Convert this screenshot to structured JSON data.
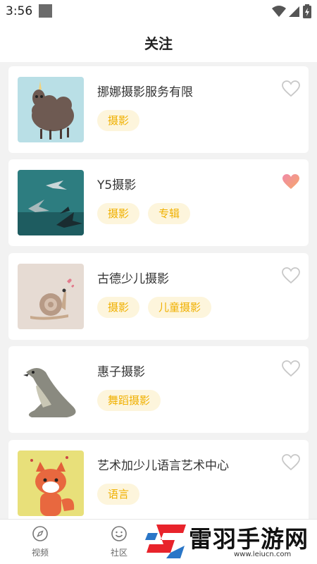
{
  "status_bar": {
    "time": "3:56"
  },
  "header": {
    "title": "关注"
  },
  "items": [
    {
      "name": "挪娜摄影服务有限",
      "tags": [
        "摄影"
      ],
      "liked": false,
      "thumb": "sheep"
    },
    {
      "name": "Y5摄影",
      "tags": [
        "摄影",
        "专辑"
      ],
      "liked": true,
      "thumb": "sea"
    },
    {
      "name": "古德少儿摄影",
      "tags": [
        "摄影",
        "儿童摄影"
      ],
      "liked": false,
      "thumb": "snail"
    },
    {
      "name": "惠子摄影",
      "tags": [
        "舞蹈摄影"
      ],
      "liked": false,
      "thumb": "sealion"
    },
    {
      "name": "艺术加少儿语言艺术中心",
      "tags": [
        "语言"
      ],
      "liked": false,
      "thumb": "fox"
    }
  ],
  "tabbar": {
    "tabs": [
      {
        "label": "视频",
        "icon": "compass-icon"
      },
      {
        "label": "社区",
        "icon": "smile-icon"
      }
    ]
  },
  "watermark": {
    "text": "雷羽手游网",
    "url": "www.leiucn.com"
  },
  "colors": {
    "tag_text": "#f0b000",
    "tag_bg": "#fdf5dc",
    "heart_liked": "#f66a8a",
    "heart_outline": "#c8c8c8"
  }
}
